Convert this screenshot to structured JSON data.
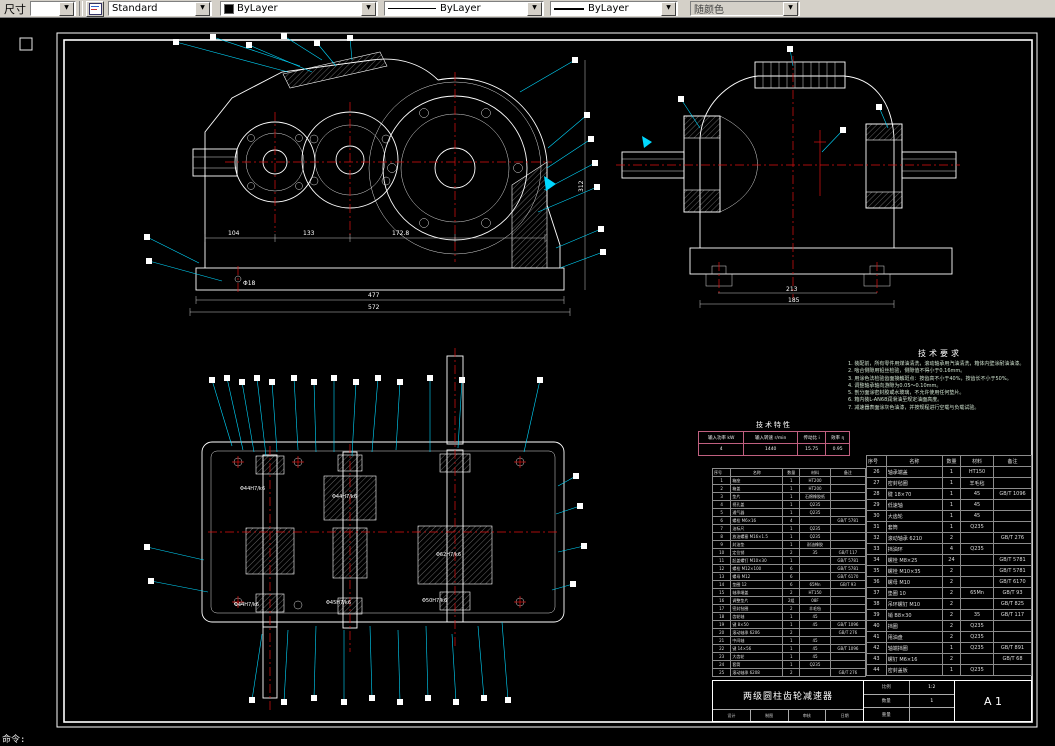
{
  "toolbar": {
    "dim_label": "尺寸",
    "style_value": "Standard",
    "color_value": "ByLayer",
    "linetype_value": "ByLayer",
    "lineweight_value": "ByLayer",
    "plotstyle_value": "随颜色"
  },
  "statusbar": {
    "command": "命令:"
  },
  "views": {
    "front": {
      "dims": {
        "a": "104",
        "b": "133",
        "c": "172.8",
        "total": "477",
        "overall": "572",
        "hole": "Φ18",
        "height": "312"
      }
    },
    "side": {
      "dims": {
        "a": "213",
        "b": "185"
      }
    },
    "plan": {
      "fits": [
        "Φ44H7/k6",
        "Φ44H7/k6",
        "Φ62H7/k6",
        "Φ44H7/k6",
        "Φ45H7/k6",
        "Φ50H7/k6"
      ]
    }
  },
  "tech_requirements": {
    "title": "技术要求",
    "items": [
      "1. 装配前，所有零件用煤油清洗，滚动轴承用汽油清洗，箱体内壁涂耐油油漆。",
      "2. 啮合侧隙用铅丝检验，侧隙值不得小于0.16mm。",
      "3. 用涂色法检验齿面接触斑点：按齿高不小于40%，按齿长不小于50%。",
      "4. 调整轴承轴向游隙为0.05～0.10mm。",
      "5. 剖分面涂密封胶或水玻璃，不允许使用任何垫片。",
      "6. 箱内装L-AN68润滑油至规定油面高度。",
      "7. 减速器表面涂灰色油漆，并按规程进行空载与负载试验。"
    ]
  },
  "tech_characteristics": {
    "title": "技术特性",
    "headers": [
      "输入功率 kW",
      "输入转速 r/min",
      "传动比 i",
      "效率 η"
    ],
    "values": [
      "4",
      "1440",
      "15.75",
      "0.95"
    ]
  },
  "bom_left": {
    "headers": [
      "序号",
      "名称",
      "数量",
      "材料",
      "备注"
    ],
    "rows": [
      [
        "1",
        "箱座",
        "1",
        "HT200",
        ""
      ],
      [
        "2",
        "箱盖",
        "1",
        "HT200",
        ""
      ],
      [
        "3",
        "垫片",
        "1",
        "石棉橡胶纸",
        ""
      ],
      [
        "4",
        "视孔盖",
        "1",
        "Q235",
        ""
      ],
      [
        "5",
        "通气器",
        "1",
        "Q235",
        ""
      ],
      [
        "6",
        "螺栓 M6×16",
        "4",
        "",
        "GB/T 5781"
      ],
      [
        "7",
        "油标尺",
        "1",
        "Q235",
        ""
      ],
      [
        "8",
        "放油螺塞 M16×1.5",
        "1",
        "Q235",
        ""
      ],
      [
        "9",
        "封油垫",
        "1",
        "耐油橡胶",
        ""
      ],
      [
        "10",
        "定位销",
        "2",
        "35",
        "GB/T 117"
      ],
      [
        "11",
        "起盖螺钉 M10×30",
        "1",
        "",
        "GB/T 5781"
      ],
      [
        "12",
        "螺栓 M12×100",
        "6",
        "",
        "GB/T 5781"
      ],
      [
        "13",
        "螺母 M12",
        "6",
        "",
        "GB/T 6170"
      ],
      [
        "14",
        "垫圈 12",
        "6",
        "65Mn",
        "GB/T 93"
      ],
      [
        "15",
        "轴承端盖",
        "2",
        "HT150",
        ""
      ],
      [
        "16",
        "调整垫片",
        "2组",
        "08F",
        ""
      ],
      [
        "17",
        "密封毡圈",
        "2",
        "羊毛毡",
        ""
      ],
      [
        "18",
        "齿轮轴",
        "1",
        "45",
        ""
      ],
      [
        "19",
        "键 8×50",
        "1",
        "45",
        "GB/T 1096"
      ],
      [
        "20",
        "滚动轴承 6206",
        "2",
        "",
        "GB/T 276"
      ],
      [
        "21",
        "中间轴",
        "1",
        "45",
        ""
      ],
      [
        "22",
        "键 14×56",
        "1",
        "45",
        "GB/T 1096"
      ],
      [
        "23",
        "大齿轮",
        "1",
        "45",
        ""
      ],
      [
        "24",
        "套筒",
        "1",
        "Q235",
        ""
      ],
      [
        "25",
        "滚动轴承 6208",
        "2",
        "",
        "GB/T 276"
      ]
    ]
  },
  "bom_right": {
    "headers": [
      "序号",
      "名称",
      "数量",
      "材料",
      "备注"
    ],
    "rows": [
      [
        "26",
        "轴承端盖",
        "1",
        "HT150",
        ""
      ],
      [
        "27",
        "密封毡圈",
        "1",
        "羊毛毡",
        ""
      ],
      [
        "28",
        "键 18×70",
        "1",
        "45",
        "GB/T 1096"
      ],
      [
        "29",
        "低速轴",
        "1",
        "45",
        ""
      ],
      [
        "30",
        "大齿轮",
        "1",
        "45",
        ""
      ],
      [
        "31",
        "套筒",
        "1",
        "Q235",
        ""
      ],
      [
        "32",
        "滚动轴承 6210",
        "2",
        "",
        "GB/T 276"
      ],
      [
        "33",
        "挡油环",
        "4",
        "Q235",
        ""
      ],
      [
        "34",
        "螺栓 M8×25",
        "24",
        "",
        "GB/T 5781"
      ],
      [
        "35",
        "螺栓 M10×35",
        "2",
        "",
        "GB/T 5781"
      ],
      [
        "36",
        "螺母 M10",
        "2",
        "",
        "GB/T 6170"
      ],
      [
        "37",
        "垫圈 10",
        "2",
        "65Mn",
        "GB/T 93"
      ],
      [
        "38",
        "吊环螺钉 M10",
        "2",
        "",
        "GB/T 825"
      ],
      [
        "39",
        "销 B8×30",
        "2",
        "35",
        "GB/T 117"
      ],
      [
        "40",
        "挡圈",
        "2",
        "Q235",
        ""
      ],
      [
        "41",
        "甩油盘",
        "2",
        "Q235",
        ""
      ],
      [
        "42",
        "轴端挡圈",
        "1",
        "Q235",
        "GB/T 891"
      ],
      [
        "43",
        "螺钉 M6×16",
        "2",
        "",
        "GB/T 68"
      ],
      [
        "44",
        "密封盖板",
        "1",
        "Q235",
        ""
      ]
    ]
  },
  "title_block": {
    "name": "两级圆柱齿轮减速器",
    "sheet": "A 1",
    "scale_label": "比例",
    "scale": "1:2",
    "qty_label": "数量",
    "qty": "1",
    "weight_label": "重量",
    "weight": "",
    "roles": [
      "设计",
      "制图",
      "审核",
      "日期"
    ]
  }
}
